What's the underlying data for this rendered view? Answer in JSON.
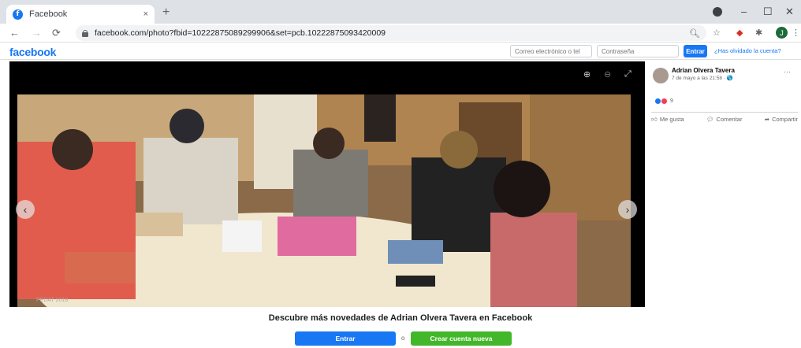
{
  "browser": {
    "tab_title": "Facebook",
    "tab_close": "×",
    "new_tab": "+",
    "url": "facebook.com/photo?fbid=10222875089299906&set=pcb.10222875093420009",
    "window_controls": [
      "–",
      "☐",
      "✕"
    ]
  },
  "fb": {
    "logo": "facebook",
    "email_placeholder": "Correo electrónico o tel",
    "password_placeholder": "Contraseña",
    "login_button": "Entrar",
    "forgot_link": "¿Has olvidado la cuenta?"
  },
  "viewer": {
    "caption": "PEDAT 2018"
  },
  "post": {
    "author": "Adrian Olvera Tavera",
    "date": "7 de mayo a las 21:58 · 🌎",
    "more": "···",
    "reaction_count": "9",
    "like_label": "Me gusta",
    "comment_label": "Comentar",
    "share_label": "Compartir"
  },
  "footer": {
    "promo_text": "Descubre más novedades de Adrian Olvera Tavera en Facebook",
    "login_button": "Entrar",
    "separator": "o",
    "signup_button": "Crear cuenta nueva"
  },
  "colors": {
    "fb_blue": "#1877f2",
    "signup_green": "#42b72a"
  }
}
